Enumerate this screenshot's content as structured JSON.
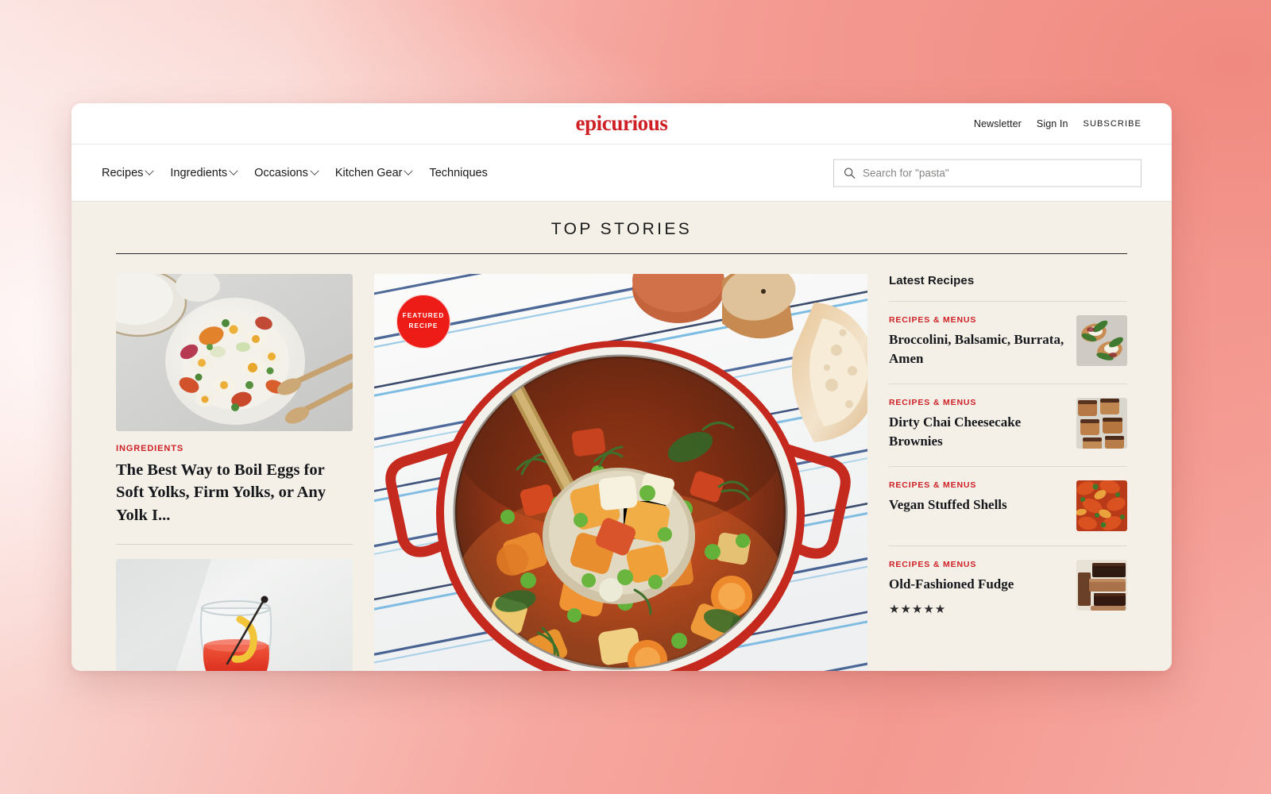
{
  "masthead": {
    "logo": "epicurious",
    "utility": [
      {
        "label": "Newsletter",
        "name": "newsletter-link"
      },
      {
        "label": "Sign In",
        "name": "sign-in-link"
      },
      {
        "label": "SUBSCRIBE",
        "name": "subscribe-link"
      }
    ]
  },
  "nav": {
    "items": [
      {
        "label": "Recipes",
        "has_chevron": true
      },
      {
        "label": "Ingredients",
        "has_chevron": true
      },
      {
        "label": "Occasions",
        "has_chevron": true
      },
      {
        "label": "Kitchen Gear",
        "has_chevron": true
      },
      {
        "label": "Techniques",
        "has_chevron": false
      }
    ]
  },
  "search": {
    "placeholder": "Search for \"pasta\"",
    "value": "",
    "icon": "search-icon"
  },
  "section": {
    "title": "TOP STORIES"
  },
  "left_column": {
    "stories": [
      {
        "kicker": "INGREDIENTS",
        "headline": "The Best Way to Boil Eggs for Soft Yolks, Firm Yolks, or Any Yolk I...",
        "image_alt": "egg-salad-photo"
      },
      {
        "kicker": "",
        "headline": "",
        "image_alt": "cocktail-photo",
        "badge_icon": "gallery-icon"
      }
    ]
  },
  "feature": {
    "badge_line1": "FEATURED",
    "badge_line2": "RECIPE",
    "image_alt": "vegetable-soup-photo"
  },
  "right_rail": {
    "title": "Latest Recipes",
    "items": [
      {
        "kicker": "RECIPES & MENUS",
        "headline": "Broccolini, Balsamic, Burrata, Amen",
        "rating": "",
        "thumb_alt": "broccolini-burrata-thumb"
      },
      {
        "kicker": "RECIPES & MENUS",
        "headline": "Dirty Chai Cheesecake Brownies",
        "rating": "",
        "thumb_alt": "chai-brownies-thumb"
      },
      {
        "kicker": "RECIPES & MENUS",
        "headline": "Vegan Stuffed Shells",
        "rating": "",
        "thumb_alt": "stuffed-shells-thumb"
      },
      {
        "kicker": "RECIPES & MENUS",
        "headline": "Old-Fashioned Fudge",
        "rating": "★★★★★",
        "thumb_alt": "fudge-thumb"
      }
    ]
  },
  "colors": {
    "brand_red": "#cf2026",
    "badge_red": "#ed1c16",
    "page_bg": "#f4f0e8",
    "backdrop_pink": "#f6a79f"
  }
}
